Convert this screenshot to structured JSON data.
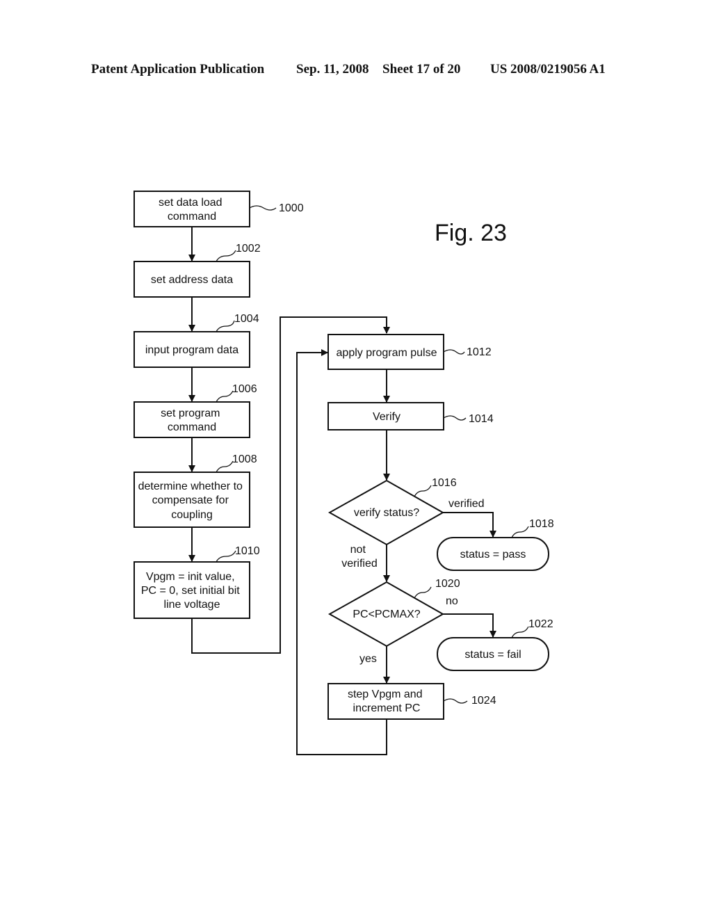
{
  "header": {
    "left": "Patent Application Publication",
    "date": "Sep. 11, 2008",
    "sheet": "Sheet 17 of 20",
    "number": "US 2008/0219056 A1"
  },
  "figure_label": "Fig. 23",
  "nodes": {
    "n1000": {
      "ref": "1000",
      "lines": [
        "set data load",
        "command"
      ]
    },
    "n1002": {
      "ref": "1002",
      "lines": [
        "set address data"
      ]
    },
    "n1004": {
      "ref": "1004",
      "lines": [
        "input program data"
      ]
    },
    "n1006": {
      "ref": "1006",
      "lines": [
        "set program",
        "command"
      ]
    },
    "n1008": {
      "ref": "1008",
      "lines": [
        "determine whether to",
        "compensate for",
        "coupling"
      ]
    },
    "n1010": {
      "ref": "1010",
      "lines": [
        "Vpgm = init value,",
        "PC = 0, set initial bit",
        "line voltage"
      ]
    },
    "n1012": {
      "ref": "1012",
      "lines": [
        "apply program pulse"
      ]
    },
    "n1014": {
      "ref": "1014",
      "lines": [
        "Verify"
      ]
    },
    "n1016": {
      "ref": "1016",
      "lines": [
        "verify status?"
      ]
    },
    "n1018": {
      "ref": "1018",
      "lines": [
        "status = pass"
      ]
    },
    "n1020": {
      "ref": "1020",
      "lines": [
        "PC<PCMAX?"
      ]
    },
    "n1022": {
      "ref": "1022",
      "lines": [
        "status = fail"
      ]
    },
    "n1024": {
      "ref": "1024",
      "lines": [
        "step Vpgm and",
        "increment PC"
      ]
    }
  },
  "edge_labels": {
    "verified": "verified",
    "not_verified": [
      "not",
      "verified"
    ],
    "no": "no",
    "yes": "yes"
  }
}
